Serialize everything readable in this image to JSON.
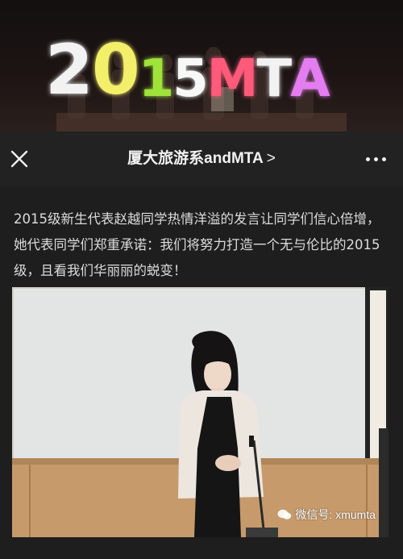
{
  "banner": {
    "text_chars": [
      {
        "ch": "2",
        "color": "#f2f2f2",
        "size": "big"
      },
      {
        "ch": "0",
        "color": "#f3ef6a",
        "size": "big"
      },
      {
        "ch": "1",
        "color": "#9fe23a",
        "size": "mid"
      },
      {
        "ch": "5",
        "color": "#f8f8f8",
        "size": "mid"
      },
      {
        "ch": "M",
        "color": "#ff5a7a",
        "size": "mid"
      },
      {
        "ch": "T",
        "color": "#f2f2f2",
        "size": "mid"
      },
      {
        "ch": "A",
        "color": "#e47df0",
        "size": "mid"
      }
    ]
  },
  "header": {
    "title": "厦大旅游系andMTA",
    "chevron": ">",
    "close_icon": "close-icon",
    "more_icon": "more-dots-icon"
  },
  "article": {
    "paragraph": "2015级新生代表赵越同学热情洋溢的发言让同学们信心倍增，她代表同学们郑重承诺：我们将努力打造一个无与伦比的2015级，且看我们华丽丽的蜕变！"
  },
  "photo": {
    "watermark": "微信号: xmumta"
  },
  "colors": {
    "page_bg": "#1e1e1e",
    "header_bg": "#222222",
    "text": "#dcdcdc"
  }
}
